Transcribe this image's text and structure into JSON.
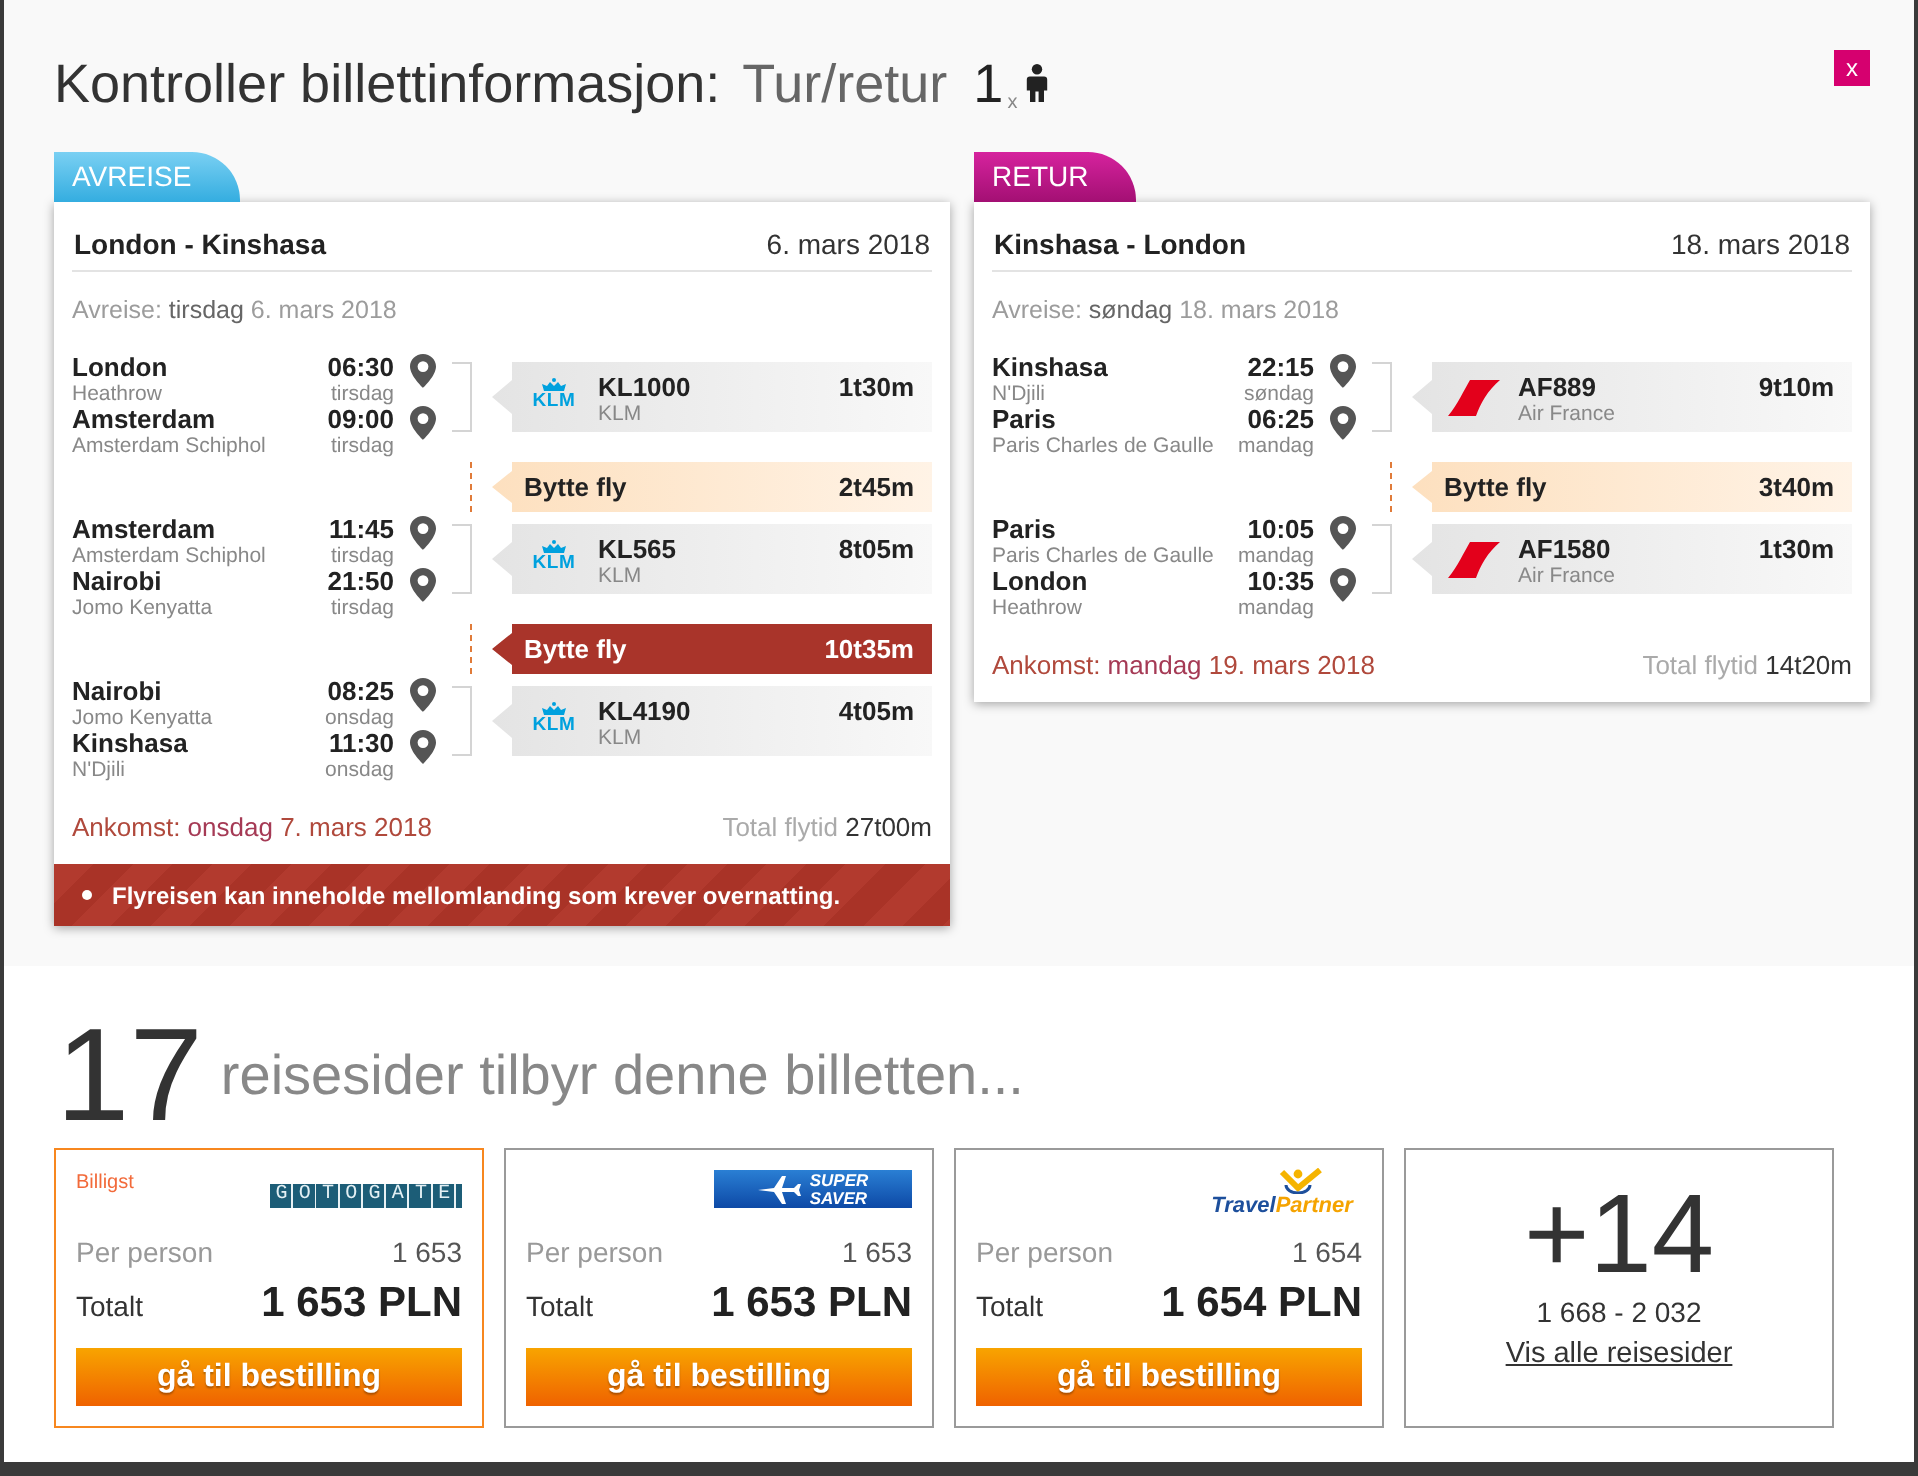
{
  "dialog": {
    "title": "Kontroller billettinformasjon:",
    "trip_type": "Tur/retur",
    "passengers": "1$_{x}$",
    "close_label": "x"
  },
  "legs": [
    {
      "kind": "outbound",
      "tab": "AVREISE",
      "route": "London - Kinshasa",
      "date": "6. mars 2018",
      "departure": {
        "label": "Avreise:",
        "day": "tirsdag",
        "date": "6. mars 2018"
      },
      "items": [
        {
          "kind": "flight",
          "stops": [
            {
              "city": "London",
              "airport": "Heathrow",
              "time": "06:30",
              "day": "tirsdag"
            },
            {
              "city": "Amsterdam",
              "airport": "Amsterdam Schiphol",
              "time": "09:00",
              "day": "tirsdag"
            }
          ],
          "logo": {
            "kind": "klm",
            "text": [
              "KLM"
            ]
          },
          "flight_number": "KL1000",
          "airline": "KLM",
          "duration": "1t30m"
        },
        {
          "kind": "layover",
          "label": "Bytte fly",
          "duration": "2t45m",
          "long": false
        },
        {
          "kind": "flight",
          "stops": [
            {
              "city": "Amsterdam",
              "airport": "Amsterdam Schiphol",
              "time": "11:45",
              "day": "tirsdag"
            },
            {
              "city": "Nairobi",
              "airport": "Jomo Kenyatta",
              "time": "21:50",
              "day": "tirsdag"
            }
          ],
          "logo": {
            "kind": "klm",
            "text": [
              "KLM"
            ]
          },
          "flight_number": "KL565",
          "airline": "KLM",
          "duration": "8t05m"
        },
        {
          "kind": "layover",
          "label": "Bytte fly",
          "duration": "10t35m",
          "long": true
        },
        {
          "kind": "flight",
          "stops": [
            {
              "city": "Nairobi",
              "airport": "Jomo Kenyatta",
              "time": "08:25",
              "day": "onsdag"
            },
            {
              "city": "Kinshasa",
              "airport": "N'Djili",
              "time": "11:30",
              "day": "onsdag"
            }
          ],
          "logo": {
            "kind": "klm",
            "text": [
              "KLM"
            ]
          },
          "flight_number": "KL4190",
          "airline": "KLM",
          "duration": "4t05m"
        }
      ],
      "arrival": {
        "label": "Ankomst:",
        "day": "onsdag",
        "date": "7. mars 2018"
      },
      "total": {
        "label": "Total flytid",
        "value": "27t00m"
      },
      "warnings": [
        "Flyreisen kan inneholde mellomlanding som krever overnatting."
      ]
    },
    {
      "kind": "return",
      "tab": "RETUR",
      "route": "Kinshasa - London",
      "date": "18. mars 2018",
      "departure": {
        "label": "Avreise:",
        "day": "søndag",
        "date": "18. mars 2018"
      },
      "items": [
        {
          "kind": "flight",
          "stops": [
            {
              "city": "Kinshasa",
              "airport": "N'Djili",
              "time": "22:15",
              "day": "søndag"
            },
            {
              "city": "Paris",
              "airport": "Paris Charles de Gaulle",
              "time": "06:25",
              "day": "mandag"
            }
          ],
          "logo": {
            "kind": "airfrance"
          },
          "flight_number": "AF889",
          "airline": "Air France",
          "duration": "9t10m"
        },
        {
          "kind": "layover",
          "label": "Bytte fly",
          "duration": "3t40m",
          "long": false
        },
        {
          "kind": "flight",
          "stops": [
            {
              "city": "Paris",
              "airport": "Paris Charles de Gaulle",
              "time": "10:05",
              "day": "mandag"
            },
            {
              "city": "London",
              "airport": "Heathrow",
              "time": "10:35",
              "day": "mandag"
            }
          ],
          "logo": {
            "kind": "airfrance"
          },
          "flight_number": "AF1580",
          "airline": "Air France",
          "duration": "1t30m"
        }
      ],
      "arrival": {
        "label": "Ankomst:",
        "day": "mandag",
        "date": "19. mars 2018"
      },
      "total": {
        "label": "Total flytid",
        "value": "14t20m"
      }
    }
  ],
  "offers": {
    "count": "17",
    "heading": "reisesider tilbyr denne billetten...",
    "vendors": [
      {
        "cheapest": true,
        "badge": "Billigst",
        "logo": {
          "kind": "gotogate",
          "text": [
            "GOTOGATE"
          ]
        },
        "per_person_label": "Per person",
        "per_person": "1 653",
        "total_label": "Totalt",
        "total": "1 653 PLN",
        "button": "gå til bestilling"
      },
      {
        "cheapest": false,
        "logo": {
          "kind": "supersaver",
          "text": [
            "SUPER",
            "SAVER"
          ]
        },
        "per_person_label": "Per person",
        "per_person": "1 653",
        "total_label": "Totalt",
        "total": "1 653 PLN",
        "button": "gå til bestilling"
      },
      {
        "cheapest": false,
        "logo": {
          "kind": "travelpartner",
          "text": [
            "Travel",
            "Partner"
          ]
        },
        "per_person_label": "Per person",
        "per_person": "1 654",
        "total_label": "Totalt",
        "total": "1 654 PLN",
        "button": "gå til bestilling"
      }
    ],
    "more": {
      "count": "+14",
      "range": "1 668 - 2 032",
      "link": "Vis alle reisesider"
    }
  }
}
